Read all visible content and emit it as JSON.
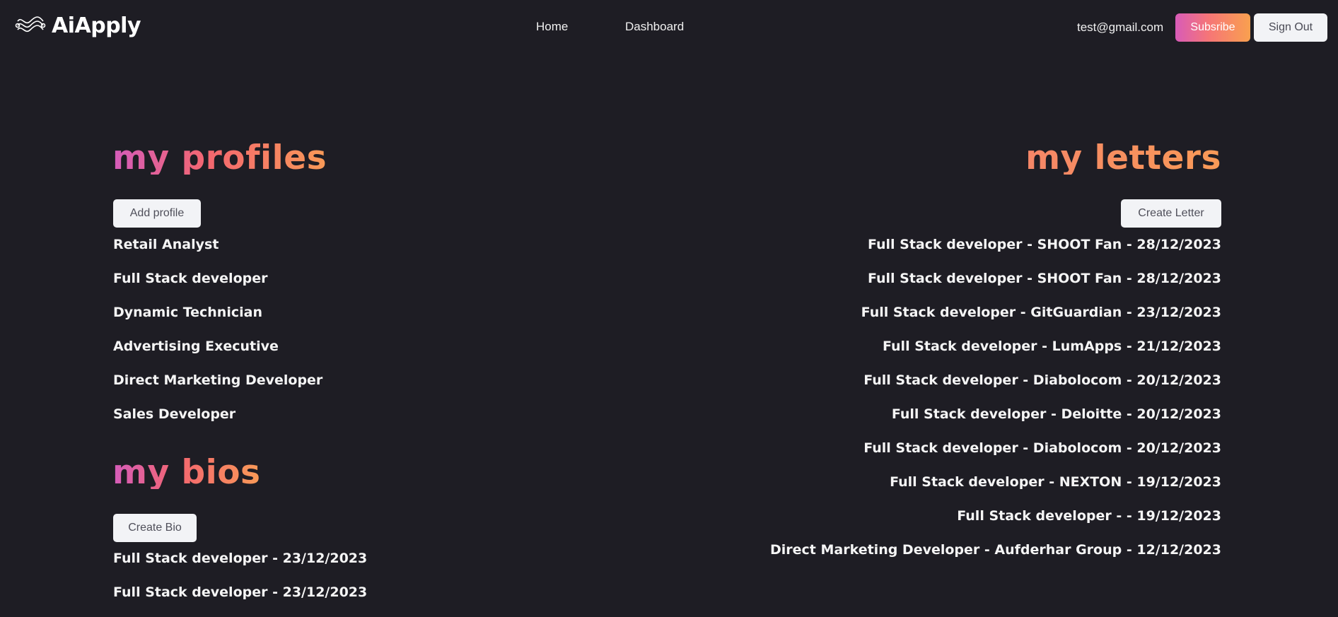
{
  "header": {
    "brand": "AiApply",
    "nav": {
      "home": "Home",
      "dashboard": "Dashboard"
    },
    "user_email": "test@gmail.com",
    "subscribe_label": "Subsribe",
    "signout_label": "Sign Out"
  },
  "profiles": {
    "title": "my profiles",
    "add_label": "Add profile",
    "items": [
      "Retail Analyst",
      "Full Stack developer",
      "Dynamic Technician",
      "Advertising Executive",
      "Direct Marketing Developer",
      "Sales Developer"
    ]
  },
  "bios": {
    "title": "my bios",
    "create_label": "Create Bio",
    "items": [
      "Full Stack developer - 23/12/2023",
      "Full Stack developer - 23/12/2023"
    ]
  },
  "letters": {
    "title": "my letters",
    "create_label": "Create Letter",
    "items": [
      "Full Stack developer - SHOOT Fan - 28/12/2023",
      "Full Stack developer - SHOOT Fan - 28/12/2023",
      "Full Stack developer - GitGuardian - 23/12/2023",
      "Full Stack developer - LumApps - 21/12/2023",
      "Full Stack developer - Diabolocom - 20/12/2023",
      "Full Stack developer - Deloitte - 20/12/2023",
      "Full Stack developer - Diabolocom - 20/12/2023",
      "Full Stack developer - NEXTON - 19/12/2023",
      "Full Stack developer - - 19/12/2023",
      "Direct Marketing Developer - Aufderhar Group - 12/12/2023"
    ]
  },
  "colors": {
    "background": "#1e1d24",
    "accent_start": "#d45cba",
    "accent_end": "#f89a57"
  }
}
